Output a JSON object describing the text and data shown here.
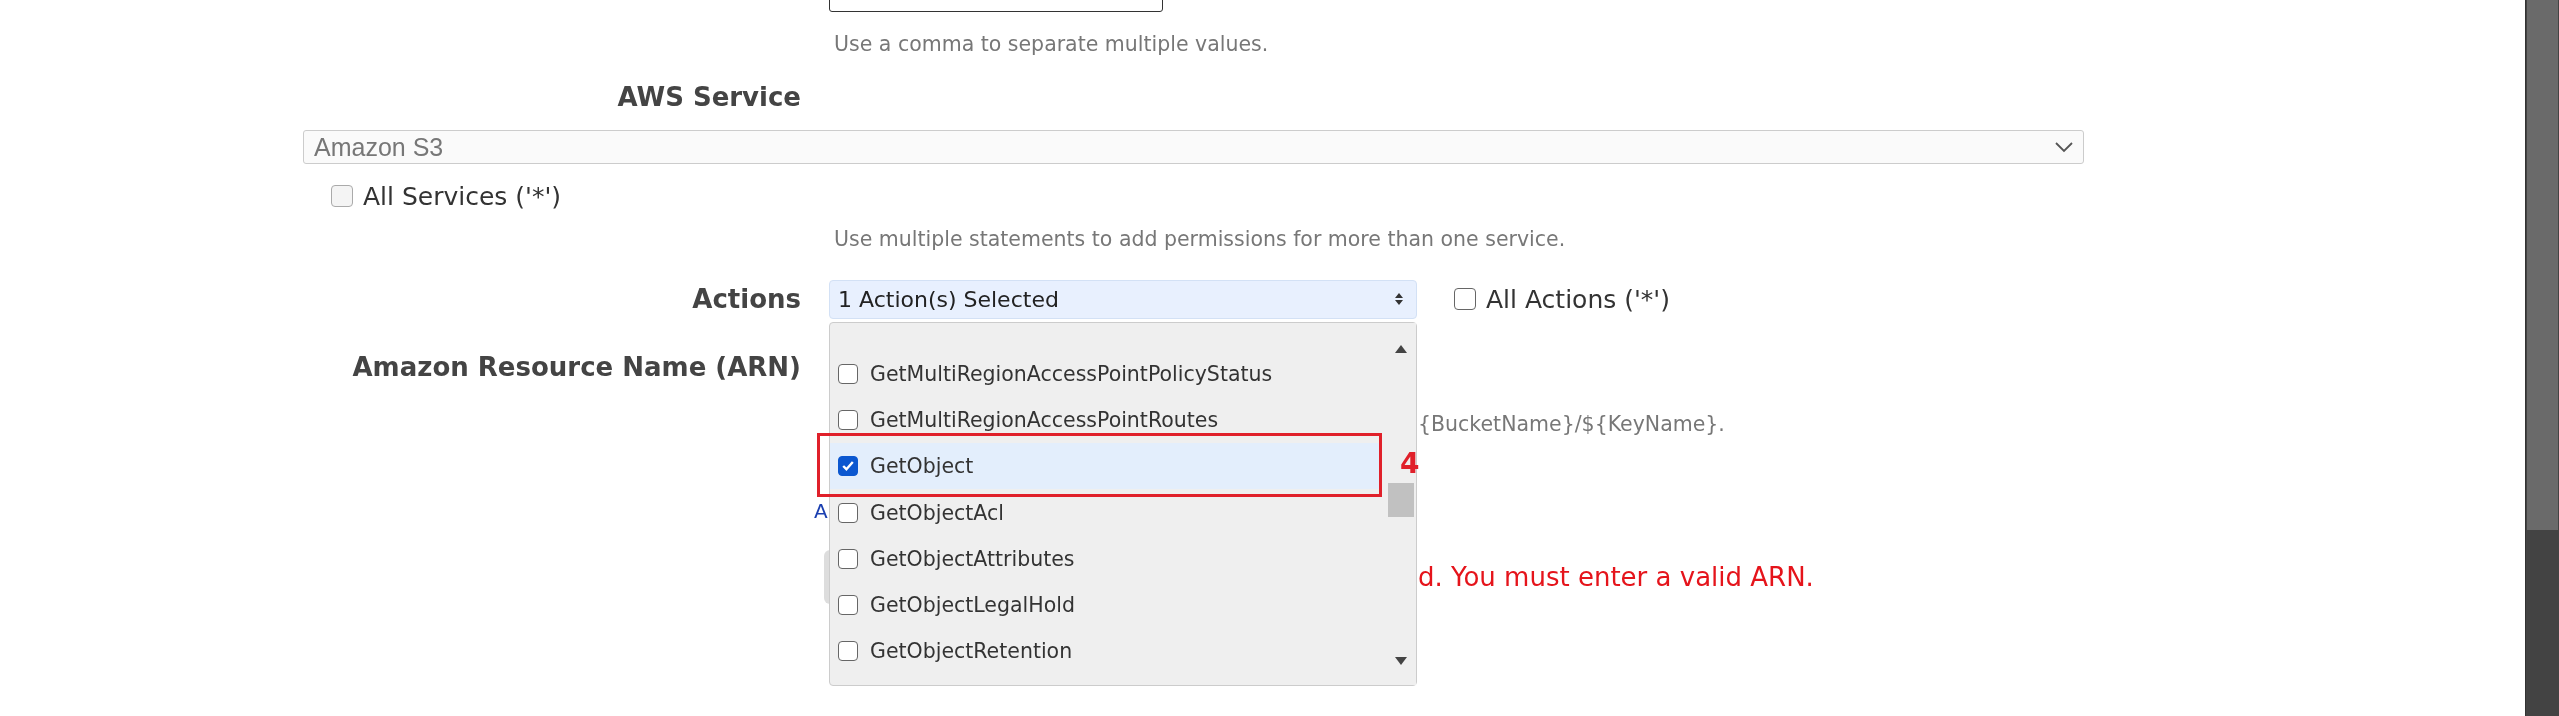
{
  "top_field": {
    "hint": "Use a comma to separate multiple values."
  },
  "aws_service": {
    "label": "AWS Service",
    "value": "Amazon S3",
    "all_services": {
      "label": "All Services ('*')",
      "checked": false
    },
    "hint": "Use multiple statements to add permissions for more than one service."
  },
  "actions": {
    "label": "Actions",
    "value": "1 Action(s) Selected",
    "all_actions": {
      "label": "All Actions ('*')",
      "checked": false
    },
    "list": [
      {
        "label": "GetMultiRegionAccessPointPolicyStatus",
        "checked": false,
        "selected": false,
        "annotated": false
      },
      {
        "label": "GetMultiRegionAccessPointRoutes",
        "checked": false,
        "selected": false,
        "annotated": false
      },
      {
        "label": "GetObject",
        "checked": true,
        "selected": true,
        "annotated": true
      },
      {
        "label": "GetObjectAcl",
        "checked": false,
        "selected": false,
        "annotated": false
      },
      {
        "label": "GetObjectAttributes",
        "checked": false,
        "selected": false,
        "annotated": false
      },
      {
        "label": "GetObjectLegalHold",
        "checked": false,
        "selected": false,
        "annotated": false
      },
      {
        "label": "GetObjectRetention",
        "checked": false,
        "selected": false,
        "annotated": false
      }
    ]
  },
  "annotation": {
    "label": "4"
  },
  "arn": {
    "label": "Amazon Resource Name (ARN)",
    "hint_tail": "{BucketName}/${KeyName}.",
    "link": "A",
    "error": "d. You must enter a valid ARN."
  }
}
